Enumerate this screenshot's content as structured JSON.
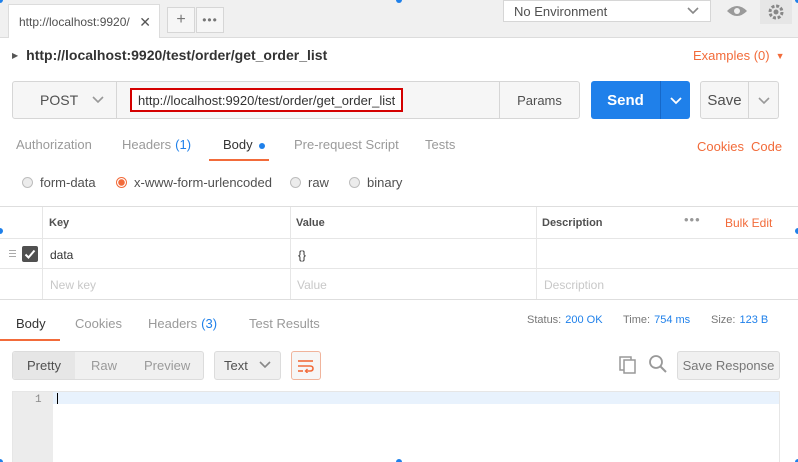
{
  "tabs": {
    "active_label": "http://localhost:9920/",
    "close_glyph": "✕",
    "new_tab_glyph": "+",
    "more_glyph": "•••"
  },
  "environment": {
    "selected": "No Environment"
  },
  "request": {
    "heading": "http://localhost:9920/test/order/get_order_list",
    "examples_label": "Examples (0)",
    "method": "POST",
    "url": "http://localhost:9920/test/order/get_order_list",
    "params_label": "Params",
    "send_label": "Send",
    "save_label": "Save"
  },
  "request_tabs": {
    "authorization": "Authorization",
    "headers": "Headers",
    "headers_count": "(1)",
    "body": "Body",
    "prerequest": "Pre-request Script",
    "tests": "Tests",
    "cookies": "Cookies",
    "code": "Code"
  },
  "body_types": {
    "options": [
      "form-data",
      "x-www-form-urlencoded",
      "raw",
      "binary"
    ],
    "selected": "x-www-form-urlencoded"
  },
  "kv_table": {
    "headers": {
      "key": "Key",
      "value": "Value",
      "description": "Description"
    },
    "bulk_edit": "Bulk Edit",
    "more_glyph": "•••",
    "rows": [
      {
        "checked": true,
        "key": "data",
        "value": "{}",
        "description": ""
      }
    ],
    "placeholders": {
      "key": "New key",
      "value": "Value",
      "description": "Description"
    }
  },
  "response": {
    "tabs": {
      "body": "Body",
      "cookies": "Cookies",
      "headers": "Headers",
      "headers_count": "(3)",
      "test_results": "Test Results"
    },
    "status_label": "Status:",
    "status_value": "200 OK",
    "time_label": "Time:",
    "time_value": "754 ms",
    "size_label": "Size:",
    "size_value": "123 B",
    "view_modes": [
      "Pretty",
      "Raw",
      "Preview"
    ],
    "format": "Text",
    "save_response_label": "Save Response",
    "editor": {
      "line_number": "1",
      "content": ""
    }
  },
  "colors": {
    "accent": "#f26b3a",
    "primary": "#1f80ea",
    "url_highlight": "#d40000"
  },
  "icons": [
    "close-icon",
    "plus-icon",
    "more-icon",
    "chevron-down-icon",
    "eye-icon",
    "gear-icon",
    "caret-right-icon",
    "checkbox-icon",
    "drag-handle-icon",
    "wrap-lines-icon",
    "copy-icon",
    "search-icon"
  ]
}
